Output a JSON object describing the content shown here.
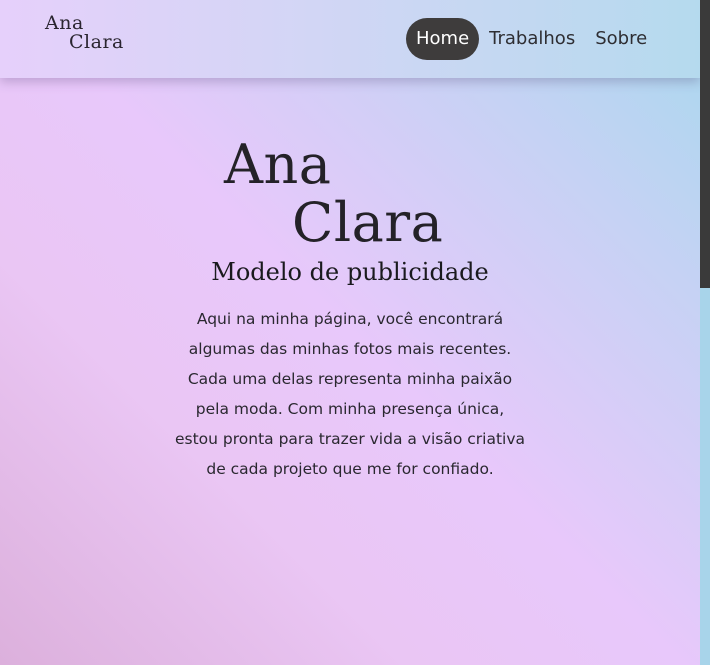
{
  "header": {
    "logo_line1": "Ana",
    "logo_line2": "Clara",
    "nav": [
      {
        "label": "Home",
        "active": true
      },
      {
        "label": "Trabalhos",
        "active": false
      },
      {
        "label": "Sobre",
        "active": false
      }
    ]
  },
  "hero": {
    "title_line1": "Ana",
    "title_line2": "Clara",
    "subtitle": "Modelo de publicidade",
    "description_lines": [
      "Aqui na minha página, você encontrará",
      "algumas das minhas fotos mais recentes.",
      "Cada uma delas representa minha paixão",
      "pela moda. Com minha presença única,",
      "estou pronta para trazer vida a visão criativa",
      "de cada projeto que me for confiado."
    ]
  },
  "colors": {
    "nav_active_bg": "#3e3c3c",
    "text_dark": "#242228",
    "gradient_blue": "#a8d8ee",
    "gradient_pink": "#e8c8fb"
  }
}
